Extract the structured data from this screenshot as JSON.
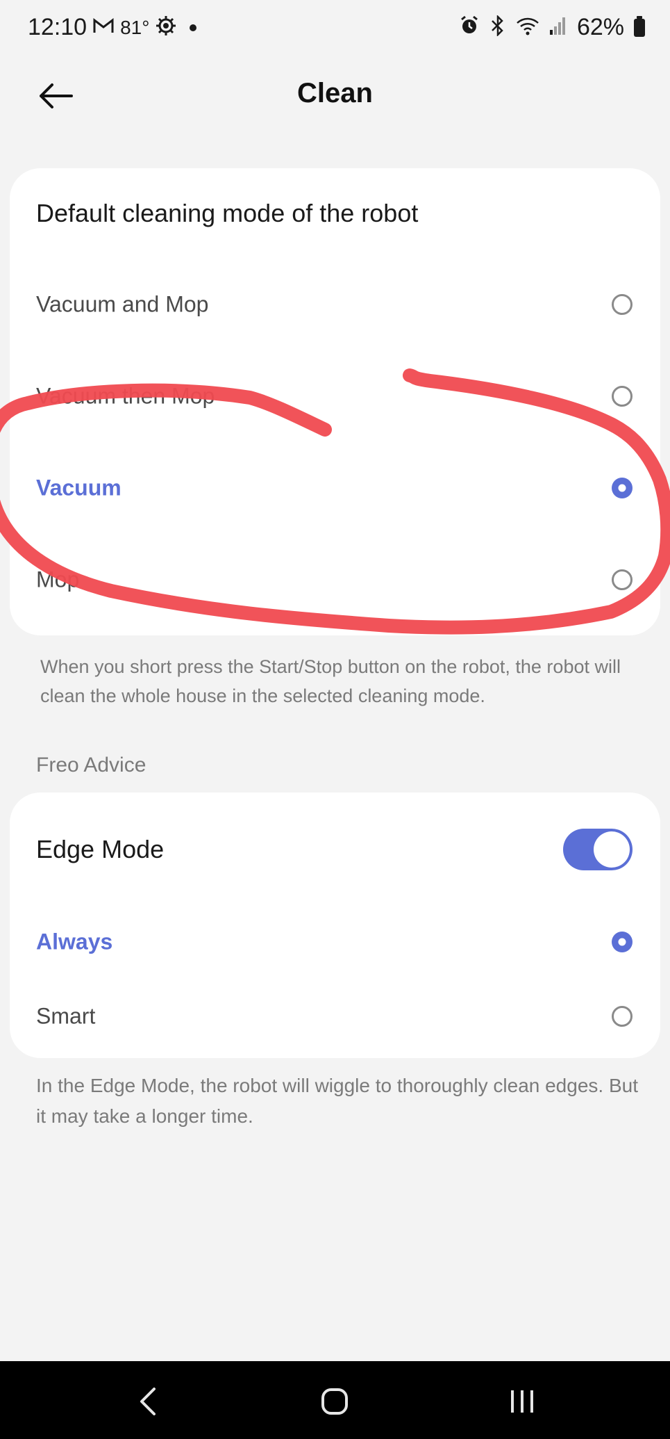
{
  "status_bar": {
    "time": "12:10",
    "temperature": "81°",
    "battery": "62%"
  },
  "header": {
    "title": "Clean"
  },
  "cleaning_mode": {
    "heading": "Default cleaning mode of the robot",
    "options": [
      {
        "label": "Vacuum and Mop",
        "selected": false
      },
      {
        "label": "Vacuum then Mop",
        "selected": false
      },
      {
        "label": "Vacuum",
        "selected": true
      },
      {
        "label": "Mop",
        "selected": false
      }
    ],
    "note": "When you short press the Start/Stop button on the robot, the robot will clean the whole house in the selected cleaning mode."
  },
  "freo_advice": {
    "section_title": "Freo Advice",
    "edge_mode_label": "Edge Mode",
    "edge_mode_enabled": true,
    "options": [
      {
        "label": "Always",
        "selected": true
      },
      {
        "label": "Smart",
        "selected": false
      }
    ],
    "note": "In the Edge Mode, the robot will wiggle to thoroughly clean edges. But it may take a longer time."
  },
  "colors": {
    "accent": "#5b6fd6",
    "annotation_red": "#f04a50"
  }
}
